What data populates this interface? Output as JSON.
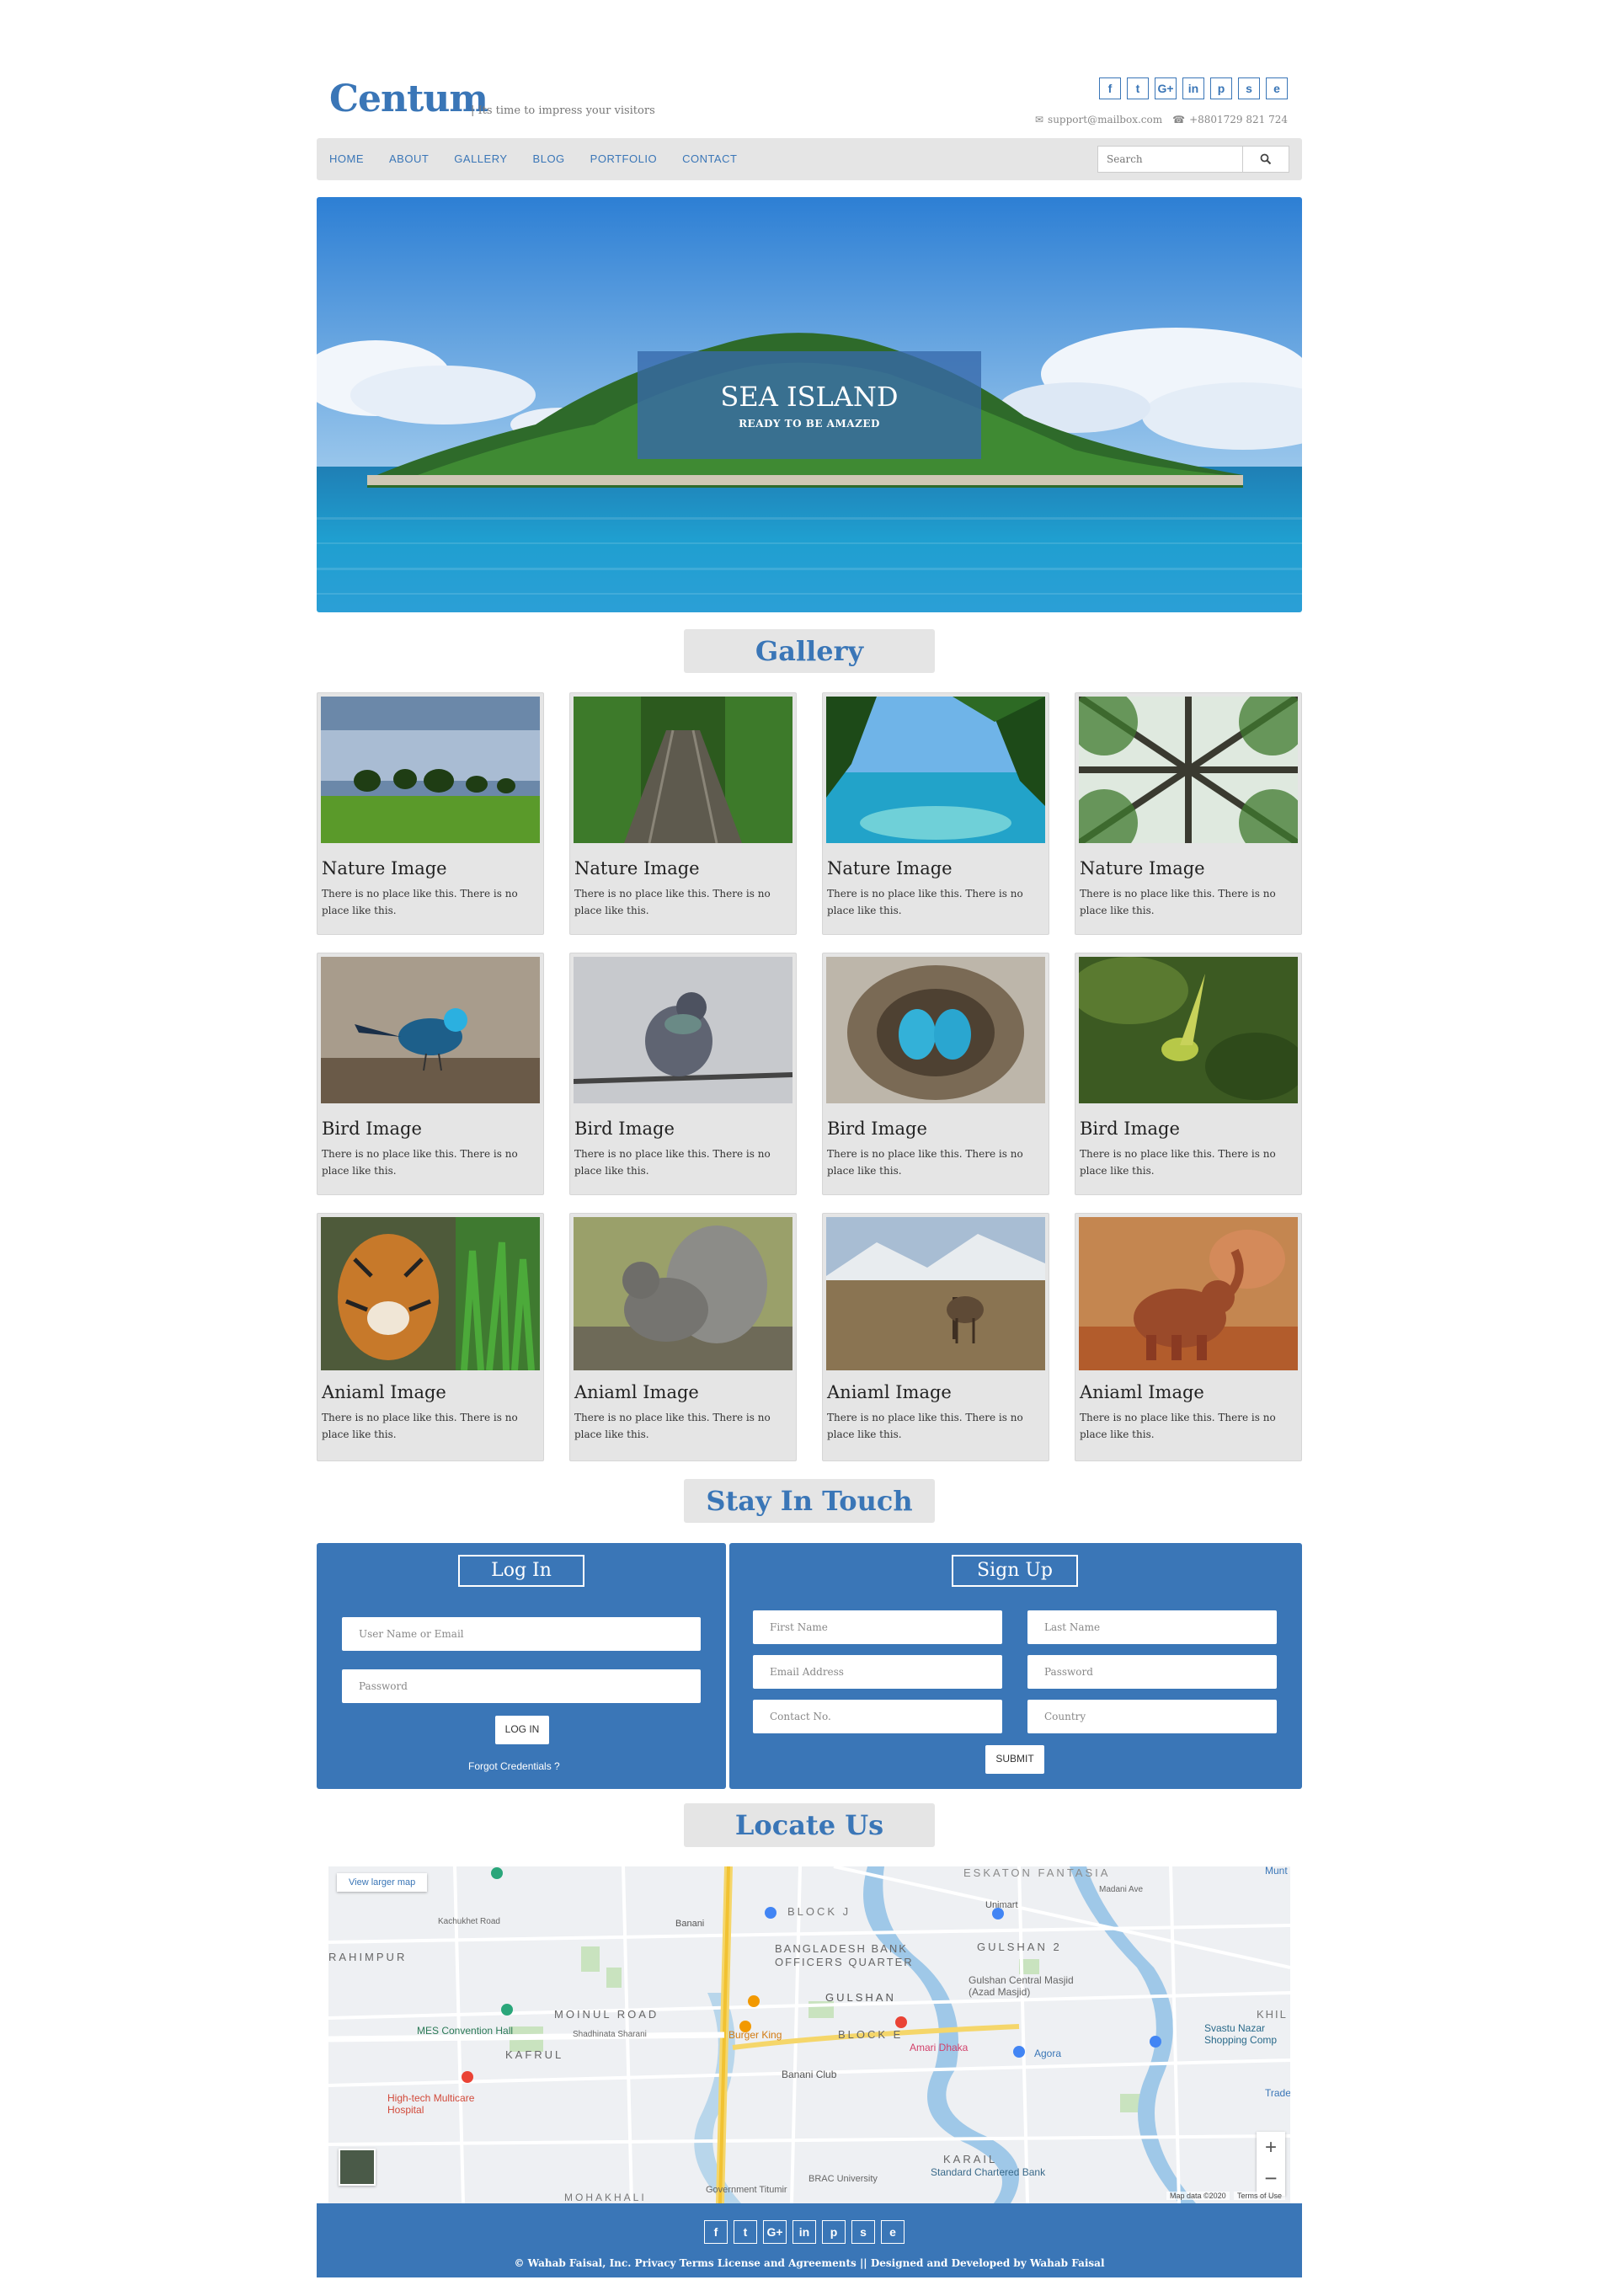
{
  "header": {
    "logo": "Centum",
    "tagline": "| Its time to impress your visitors",
    "socials": [
      "f",
      "t",
      "G+",
      "in",
      "p",
      "s",
      "e"
    ],
    "email": "support@mailbox.com",
    "phone": "+8801729 821 724"
  },
  "nav": {
    "items": [
      "HOME",
      "ABOUT",
      "GALLERY",
      "BLOG",
      "PORTFOLIO",
      "CONTACT"
    ],
    "search_placeholder": "Search"
  },
  "hero": {
    "title": "SEA ISLAND",
    "subtitle": "READY TO BE AMAZED"
  },
  "gallery": {
    "heading": "Gallery",
    "cards": [
      {
        "title": "Nature Image",
        "text": "There is no place like this. There is no place like this."
      },
      {
        "title": "Nature Image",
        "text": "There is no place like this. There is no place like this."
      },
      {
        "title": "Nature Image",
        "text": "There is no place like this. There is no place like this."
      },
      {
        "title": "Nature Image",
        "text": "There is no place like this. There is no place like this."
      },
      {
        "title": "Bird Image",
        "text": "There is no place like this. There is no place like this."
      },
      {
        "title": "Bird Image",
        "text": "There is no place like this. There is no place like this."
      },
      {
        "title": "Bird Image",
        "text": "There is no place like this. There is no place like this."
      },
      {
        "title": "Bird Image",
        "text": "There is no place like this. There is no place like this."
      },
      {
        "title": "Aniaml Image",
        "text": "There is no place like this. There is no place like this."
      },
      {
        "title": "Aniaml Image",
        "text": "There is no place like this. There is no place like this."
      },
      {
        "title": "Aniaml Image",
        "text": "There is no place like this. There is no place like this."
      },
      {
        "title": "Aniaml Image",
        "text": "There is no place like this. There is no place like this."
      }
    ]
  },
  "touch": {
    "heading": "Stay In Touch",
    "login": {
      "title": "Log In",
      "user_placeholder": "User Name or Email",
      "password_placeholder": "Password",
      "button": "LOG IN",
      "forgot": "Forgot Credentials ?"
    },
    "signup": {
      "title": "Sign Up",
      "first_name": "First Name",
      "last_name": "Last Name",
      "email": "Email Address",
      "password": "Password",
      "contact": "Contact No.",
      "country": "Country",
      "button": "SUBMIT"
    }
  },
  "locate": {
    "heading": "Locate Us",
    "view_larger": "View larger map",
    "labels": [
      "ESKATON FANTASIA",
      "BLOCK J",
      "BANGLADESH BANK OFFICERS QUARTER",
      "GULSHAN 2",
      "GULSHAN",
      "Gulshan Central Masjid (Azad Masjid)",
      "BLOCK E",
      "RAHIMPUR",
      "MOINUL ROAD",
      "MES Convention Hall",
      "Shadhinata Sharani",
      "KAFRUL",
      "Burger King",
      "Banani Club",
      "Amari Dhaka",
      "Agora",
      "Unimart",
      "High-tech Multicare Hospital",
      "Svastu Nazar Shopping Comp",
      "KARAIL",
      "Standard Chartered Bank",
      "BRAC University",
      "Government Titumir",
      "MOHAKHALI",
      "Banani",
      "Madani Ave",
      "Kachukhet Road",
      "Trade",
      "KHIL",
      "Munt"
    ],
    "map_data": "Map data ©2020",
    "terms": "Terms of Use"
  },
  "footer": {
    "socials": [
      "f",
      "t",
      "G+",
      "in",
      "p",
      "s",
      "e"
    ],
    "copyright": "© Wahab Faisal, Inc.  Privacy  Terms  License and Agreements  ||  Designed and Developed by Wahab Faisal"
  },
  "colors": {
    "brand": "#3a76b7",
    "panel": "#e5e5e5"
  }
}
